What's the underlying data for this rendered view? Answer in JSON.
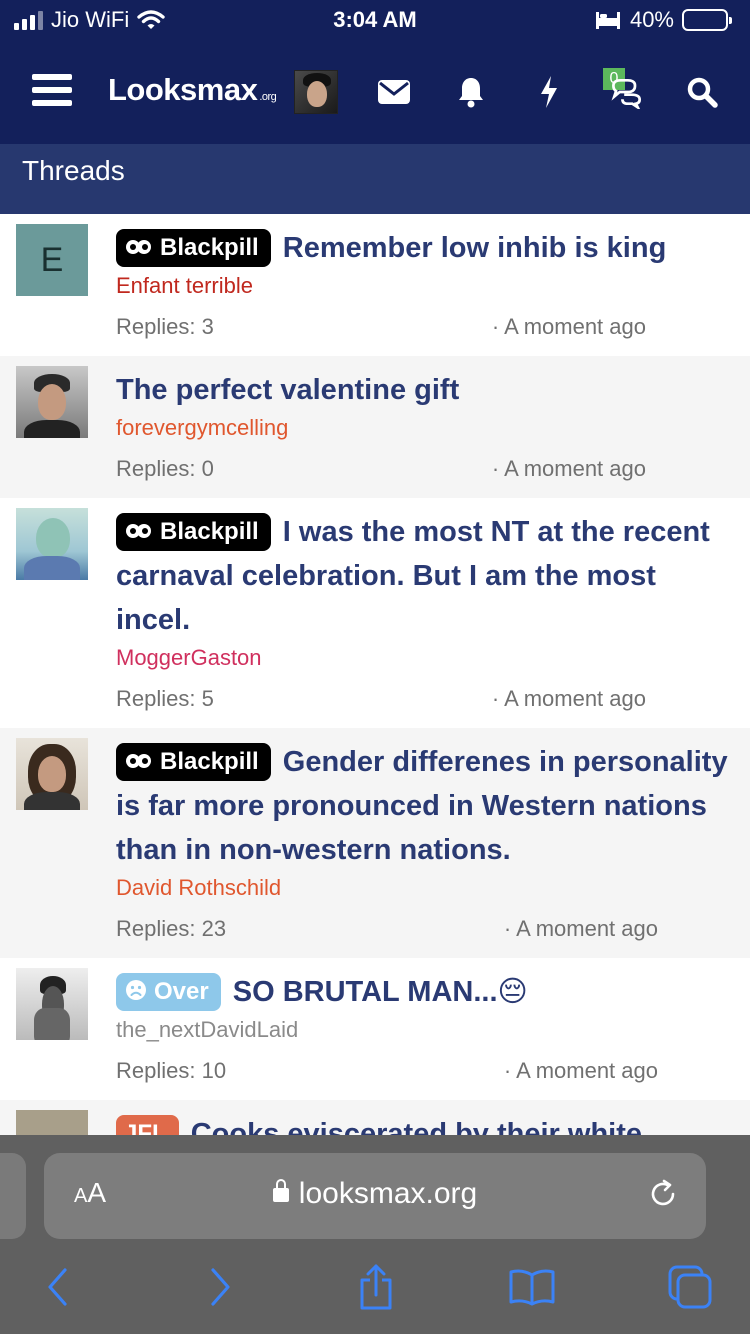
{
  "status_bar": {
    "carrier": "Jio WiFi",
    "time": "3:04 AM",
    "battery": "40%",
    "battery_level": 0.4
  },
  "header": {
    "logo_main": "Looksmax",
    "logo_suffix": ".org",
    "conversations_badge": "0",
    "icons": [
      "menu-icon",
      "envelope-icon",
      "bell-icon",
      "bolt-icon",
      "chat-bubbles-icon",
      "search-icon"
    ]
  },
  "section": {
    "title": "Threads"
  },
  "threads": [
    {
      "prefix": "Blackpill",
      "title": "Remember low inhib is king",
      "author": "Enfant terrible",
      "author_color": "#c0281e",
      "replies": "Replies: 3",
      "time": "· A moment ago",
      "avatar": "E"
    },
    {
      "prefix": "",
      "title": "The perfect valentine gift",
      "author": "forevergymcelling",
      "author_color": "#e0572e",
      "replies": "Replies: 0",
      "time": "· A moment ago"
    },
    {
      "prefix": "Blackpill",
      "title": "I was the most NT at the recent carnaval celebration. But I am the most incel.",
      "author": "MoggerGaston",
      "author_color": "#d0305e",
      "replies": "Replies: 5",
      "time": "· A moment ago"
    },
    {
      "prefix": "Blackpill",
      "title": "Gender differenes in personality is far more pronounced in Western nations than in non-western nations.",
      "author": "David Rothschild",
      "author_color": "#e0572e",
      "replies": "Replies: 23",
      "time": "· A moment ago"
    },
    {
      "prefix": "Over",
      "title": "SO BRUTAL MAN...😔",
      "author": "the_nextDavidLaid",
      "author_color": "#8a8a8a",
      "replies": "Replies: 10",
      "time": "· A moment ago"
    },
    {
      "prefix": "JFL",
      "title": "Cooks eviscerated by their white"
    }
  ],
  "safari": {
    "aa_label_small": "A",
    "aa_label_big": "A",
    "url": "looksmax.org",
    "icons": [
      "back-icon",
      "forward-icon",
      "share-icon",
      "bookmarks-icon",
      "tabs-icon"
    ]
  }
}
